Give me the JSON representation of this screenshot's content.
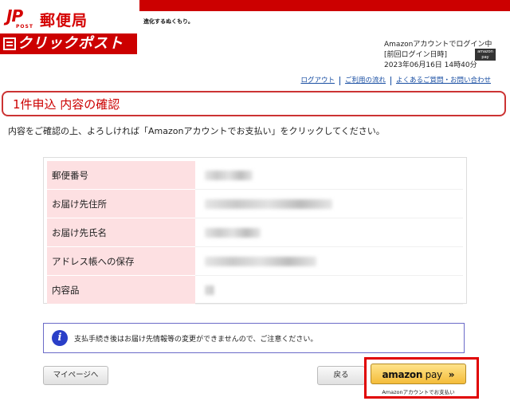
{
  "header": {
    "logo_jp": "JP",
    "logo_post": "POST",
    "logo_yubin": "郵便局",
    "tagline": "進化するぬくもり。",
    "clickpost": "クリックポスト"
  },
  "login": {
    "line1": "Amazonアカウントでログイン中",
    "line2": "[前回ログイン日時]",
    "line3": "2023年06月16日 14時40分",
    "badge_line1": "amazon",
    "badge_line2": "pay"
  },
  "nav": {
    "logout": "ログアウト",
    "flow": "ご利用の流れ",
    "faq": "よくあるご質問・お問い合わせ"
  },
  "page": {
    "title": "1件申込 内容の確認",
    "instruction": "内容をご確認の上、よろしければ「Amazonアカウントでお支払い」をクリックしてください。"
  },
  "table": {
    "rows": [
      {
        "label": "郵便番号"
      },
      {
        "label": "お届け先住所"
      },
      {
        "label": "お届け先氏名"
      },
      {
        "label": "アドレス帳への保存"
      },
      {
        "label": "内容品"
      }
    ]
  },
  "notice": {
    "icon": "i",
    "text": "支払手続き後はお届け先情報等の変更ができませんので、ご注意ください。"
  },
  "buttons": {
    "mypage": "マイページへ",
    "back": "戻る",
    "amazonpay_brand": "amazon",
    "amazonpay_pay": " pay",
    "amazonpay_chevron": "»",
    "amazonpay_caption": "Amazonアカウントでお支払い"
  }
}
